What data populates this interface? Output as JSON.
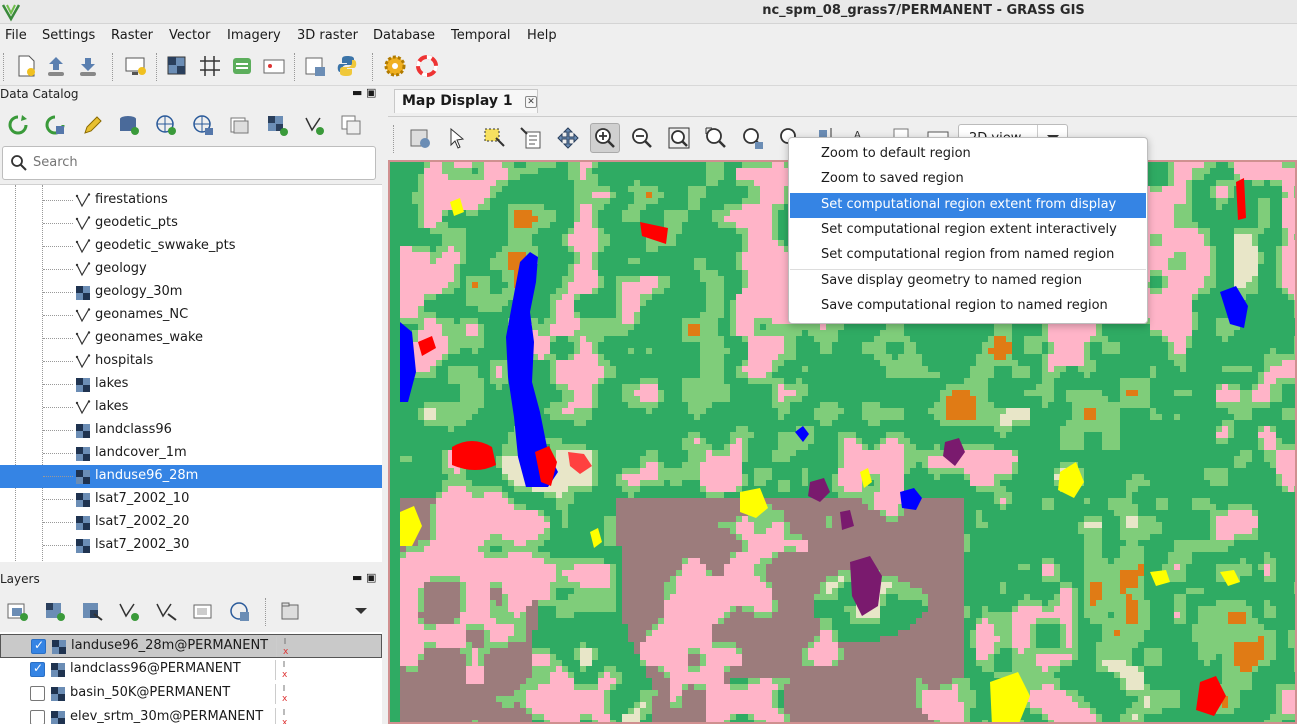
{
  "window": {
    "title": "nc_spm_08_grass7/PERMANENT - GRASS GIS"
  },
  "menubar": {
    "items": [
      "File",
      "Settings",
      "Raster",
      "Vector",
      "Imagery",
      "3D raster",
      "Database",
      "Temporal",
      "Help"
    ]
  },
  "data_catalog": {
    "title": "Data Catalog",
    "search_placeholder": "Search",
    "items": [
      {
        "label": "firestations",
        "type": "vector"
      },
      {
        "label": "geodetic_pts",
        "type": "vector"
      },
      {
        "label": "geodetic_swwake_pts",
        "type": "vector"
      },
      {
        "label": "geology",
        "type": "vector"
      },
      {
        "label": "geology_30m",
        "type": "raster"
      },
      {
        "label": "geonames_NC",
        "type": "vector"
      },
      {
        "label": "geonames_wake",
        "type": "vector"
      },
      {
        "label": "hospitals",
        "type": "vector"
      },
      {
        "label": "lakes",
        "type": "raster"
      },
      {
        "label": "lakes",
        "type": "vector"
      },
      {
        "label": "landclass96",
        "type": "raster"
      },
      {
        "label": "landcover_1m",
        "type": "raster"
      },
      {
        "label": "landuse96_28m",
        "type": "raster",
        "selected": true
      },
      {
        "label": "lsat7_2002_10",
        "type": "raster"
      },
      {
        "label": "lsat7_2002_20",
        "type": "raster"
      },
      {
        "label": "lsat7_2002_30",
        "type": "raster"
      }
    ]
  },
  "layers": {
    "title": "Layers",
    "items": [
      {
        "label": "landuse96_28m@PERMANENT",
        "checked": true,
        "active": true
      },
      {
        "label": "landclass96@PERMANENT",
        "checked": true,
        "active": false
      },
      {
        "label": "basin_50K@PERMANENT",
        "checked": false,
        "active": false
      },
      {
        "label": "elev_srtm_30m@PERMANENT",
        "checked": false,
        "active": false
      }
    ]
  },
  "map_display": {
    "tab_label": "Map Display 1",
    "view_mode": "2D view"
  },
  "zoom_menu": {
    "items": [
      "Zoom to default region",
      "Zoom to saved region",
      "Set computational region extent from display",
      "Set computational region extent interactively",
      "Set computational region from named region",
      "Save display geometry to named region",
      "Save computational region to named region"
    ],
    "highlighted_index": 2
  },
  "colors": {
    "accent": "#3584e4",
    "map_forest": "#2fab63",
    "map_grass": "#7fcd7a",
    "map_developed": "#ffb4c8",
    "map_urban": "#9c7c7c",
    "map_water": "#0000ff",
    "map_agri": "#e6817f",
    "map_orange": "#e07b15",
    "map_yellow": "#ffff00",
    "map_purple": "#7a1a6e",
    "map_red": "#ff0000",
    "map_beige": "#e8e6c8"
  }
}
